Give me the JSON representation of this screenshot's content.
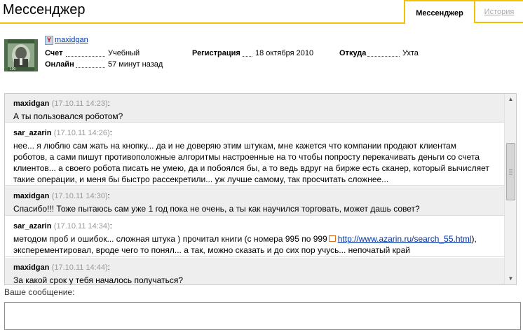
{
  "header": {
    "title": "Мессенджер",
    "tabs": [
      {
        "label": "Мессенджер",
        "active": true
      },
      {
        "label": "История",
        "active": false
      }
    ],
    "accent_color": "#f2c200"
  },
  "profile": {
    "username": "maxidgan",
    "account_icon": "yandex-y-icon",
    "fields": {
      "account": {
        "label": "Счет",
        "value": "Учебный"
      },
      "online": {
        "label": "Онлайн",
        "value": "57 минут назад"
      },
      "registration": {
        "label": "Регистрация",
        "value": "18 октября 2010"
      },
      "location": {
        "label": "Откуда",
        "value": "Ухта"
      }
    }
  },
  "messages": [
    {
      "author": "maxidgan",
      "time": "(17.10.11 14:23)",
      "lines": [
        "А ты пользовался роботом?"
      ]
    },
    {
      "author": "sar_azarin",
      "time": "(17.10.11 14:26)",
      "lines": [
        "нее... я люблю сам жать на кнопку... да и не доверяю этим штукам, мне кажется что компании продают клиентам",
        "роботов, а сами пишут противоположные алгоритмы настроенные на то чтобы попросту перекачивать деньги со счета",
        "клиентов... а своего робота писать не умею, да и побоялся бы, а то ведь вдруг на бирже есть сканер, который вычисляет",
        "такие операции, и меня бы быстро рассекретили... уж лучше самому, так просчитать сложнее..."
      ]
    },
    {
      "author": "maxidgan",
      "time": "(17.10.11 14:30)",
      "lines": [
        "Спасибо!!! Тоже пытаюсь сам уже 1 год пока не очень, а ты как научился торговать, может дашь совет?"
      ]
    },
    {
      "author": "sar_azarin",
      "time": "(17.10.11 14:34)",
      "line1_before": "методом проб и ошибок... сложная штука ) прочитал книги (с номера 995 по 999",
      "link": "http://www.azarin.ru/search_55.html",
      "line1_after": "),",
      "line2": "эксперементировал, вроде чего то понял... а так, можно сказать и до сих пор учусь... непочатый край"
    },
    {
      "author": "maxidgan",
      "time": "(17.10.11 14:44)",
      "lines": [
        "За какой срок у тебя началось получаться?"
      ]
    }
  ],
  "input": {
    "label": "Ваше сообщение:",
    "value": "",
    "placeholder": ""
  },
  "scrollbar": {
    "up_icon": "arrow-up-icon",
    "down_icon": "arrow-down-icon"
  }
}
